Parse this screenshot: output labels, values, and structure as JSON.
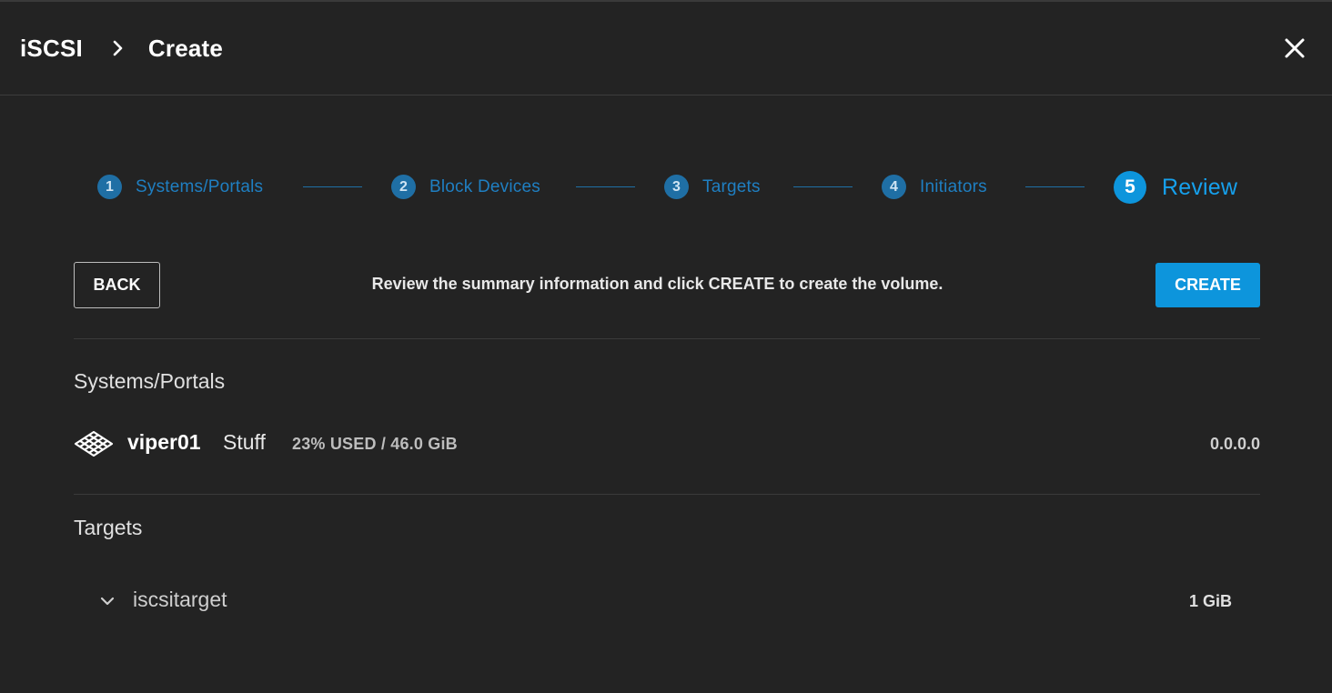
{
  "header": {
    "breadcrumb": [
      "iSCSI",
      "Create"
    ],
    "close_icon": "close-icon"
  },
  "stepper": {
    "steps": [
      {
        "number": "1",
        "label": "Systems/Portals"
      },
      {
        "number": "2",
        "label": "Block Devices"
      },
      {
        "number": "3",
        "label": "Targets"
      },
      {
        "number": "4",
        "label": "Initiators"
      },
      {
        "number": "5",
        "label": "Review"
      }
    ],
    "active_step": "5"
  },
  "actions": {
    "back_label": "BACK",
    "instructions": "Review the summary information and click CREATE to create the volume.",
    "create_label": "CREATE"
  },
  "systems_section": {
    "title": "Systems/Portals",
    "system": {
      "logo_icon": "storage-system-logo-icon",
      "name": "viper01",
      "pool": "Stuff",
      "usage": "23% USED / 46.0 GiB",
      "ip": "0.0.0.0"
    }
  },
  "targets_section": {
    "title": "Targets",
    "targets": [
      {
        "name": "iscsitarget",
        "size": "1 GiB",
        "expand_icon": "chevron-down-icon"
      }
    ]
  },
  "colors": {
    "background": "#232323",
    "accent": "#0d95dc",
    "step_inactive": "#1f6fa5"
  }
}
